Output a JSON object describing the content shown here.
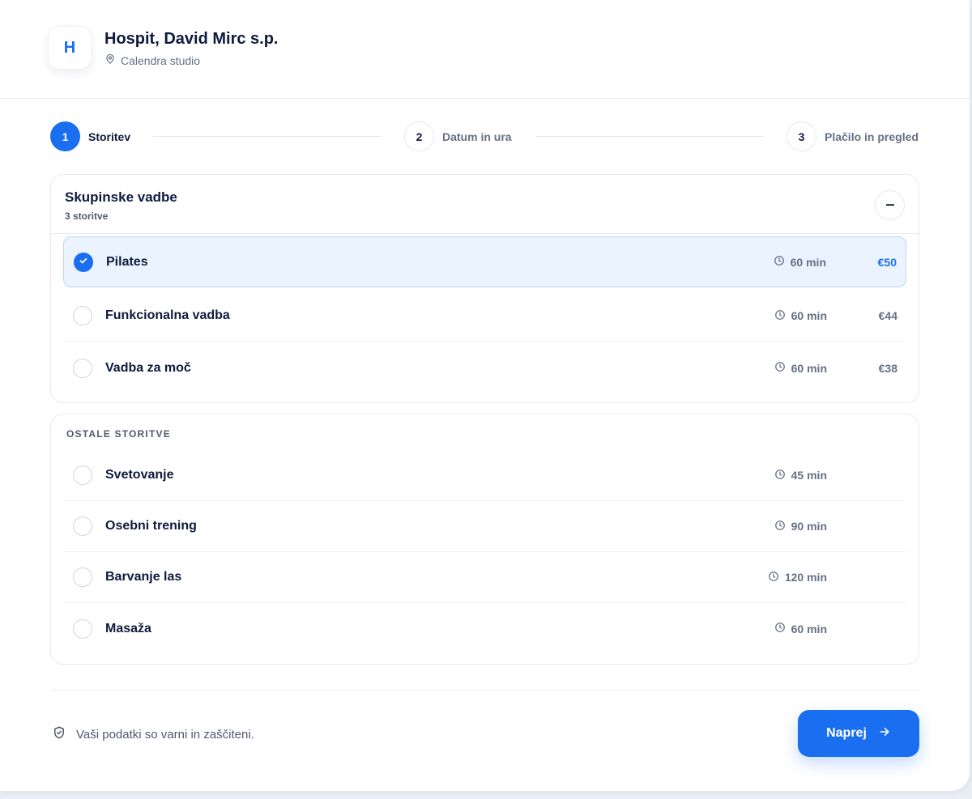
{
  "business": {
    "logo_letter": "H",
    "name": "Hospit, David Mirc s.p.",
    "location": "Calendra studio"
  },
  "stepper": {
    "steps": [
      {
        "number": "1",
        "label": "Storitev",
        "state": "active"
      },
      {
        "number": "2",
        "label": "Datum in ura",
        "state": "inactive"
      },
      {
        "number": "3",
        "label": "Plačilo in pregled",
        "state": "inactive"
      }
    ]
  },
  "group_vadbe": {
    "title": "Skupinske vadbe",
    "count": "3 storitve",
    "collapse_icon": "minus-icon",
    "items": [
      {
        "name": "Pilates",
        "duration": "60 min",
        "price": "€50",
        "selected": true
      },
      {
        "name": "Funkcionalna vadba",
        "duration": "60 min",
        "price": "€44",
        "selected": false
      },
      {
        "name": "Vadba za moč",
        "duration": "60 min",
        "price": "€38",
        "selected": false
      }
    ]
  },
  "group_ostale": {
    "title": "OSTALE STORITVE",
    "items": [
      {
        "name": "Svetovanje",
        "duration": "45 min",
        "selected": false
      },
      {
        "name": "Osebni trening",
        "duration": "90 min",
        "selected": false
      },
      {
        "name": "Barvanje las",
        "duration": "120 min",
        "selected": false
      },
      {
        "name": "Masaža",
        "duration": "60 min",
        "selected": false
      }
    ]
  },
  "footer": {
    "secure_text": "Vaši podatki so varni in zaščiteni.",
    "next_label": "Naprej"
  },
  "colors": {
    "accent": "#1a6ff0",
    "selected_bg": "#eaf3ff",
    "text_primary": "#0f1b3d",
    "text_muted": "#667085"
  }
}
